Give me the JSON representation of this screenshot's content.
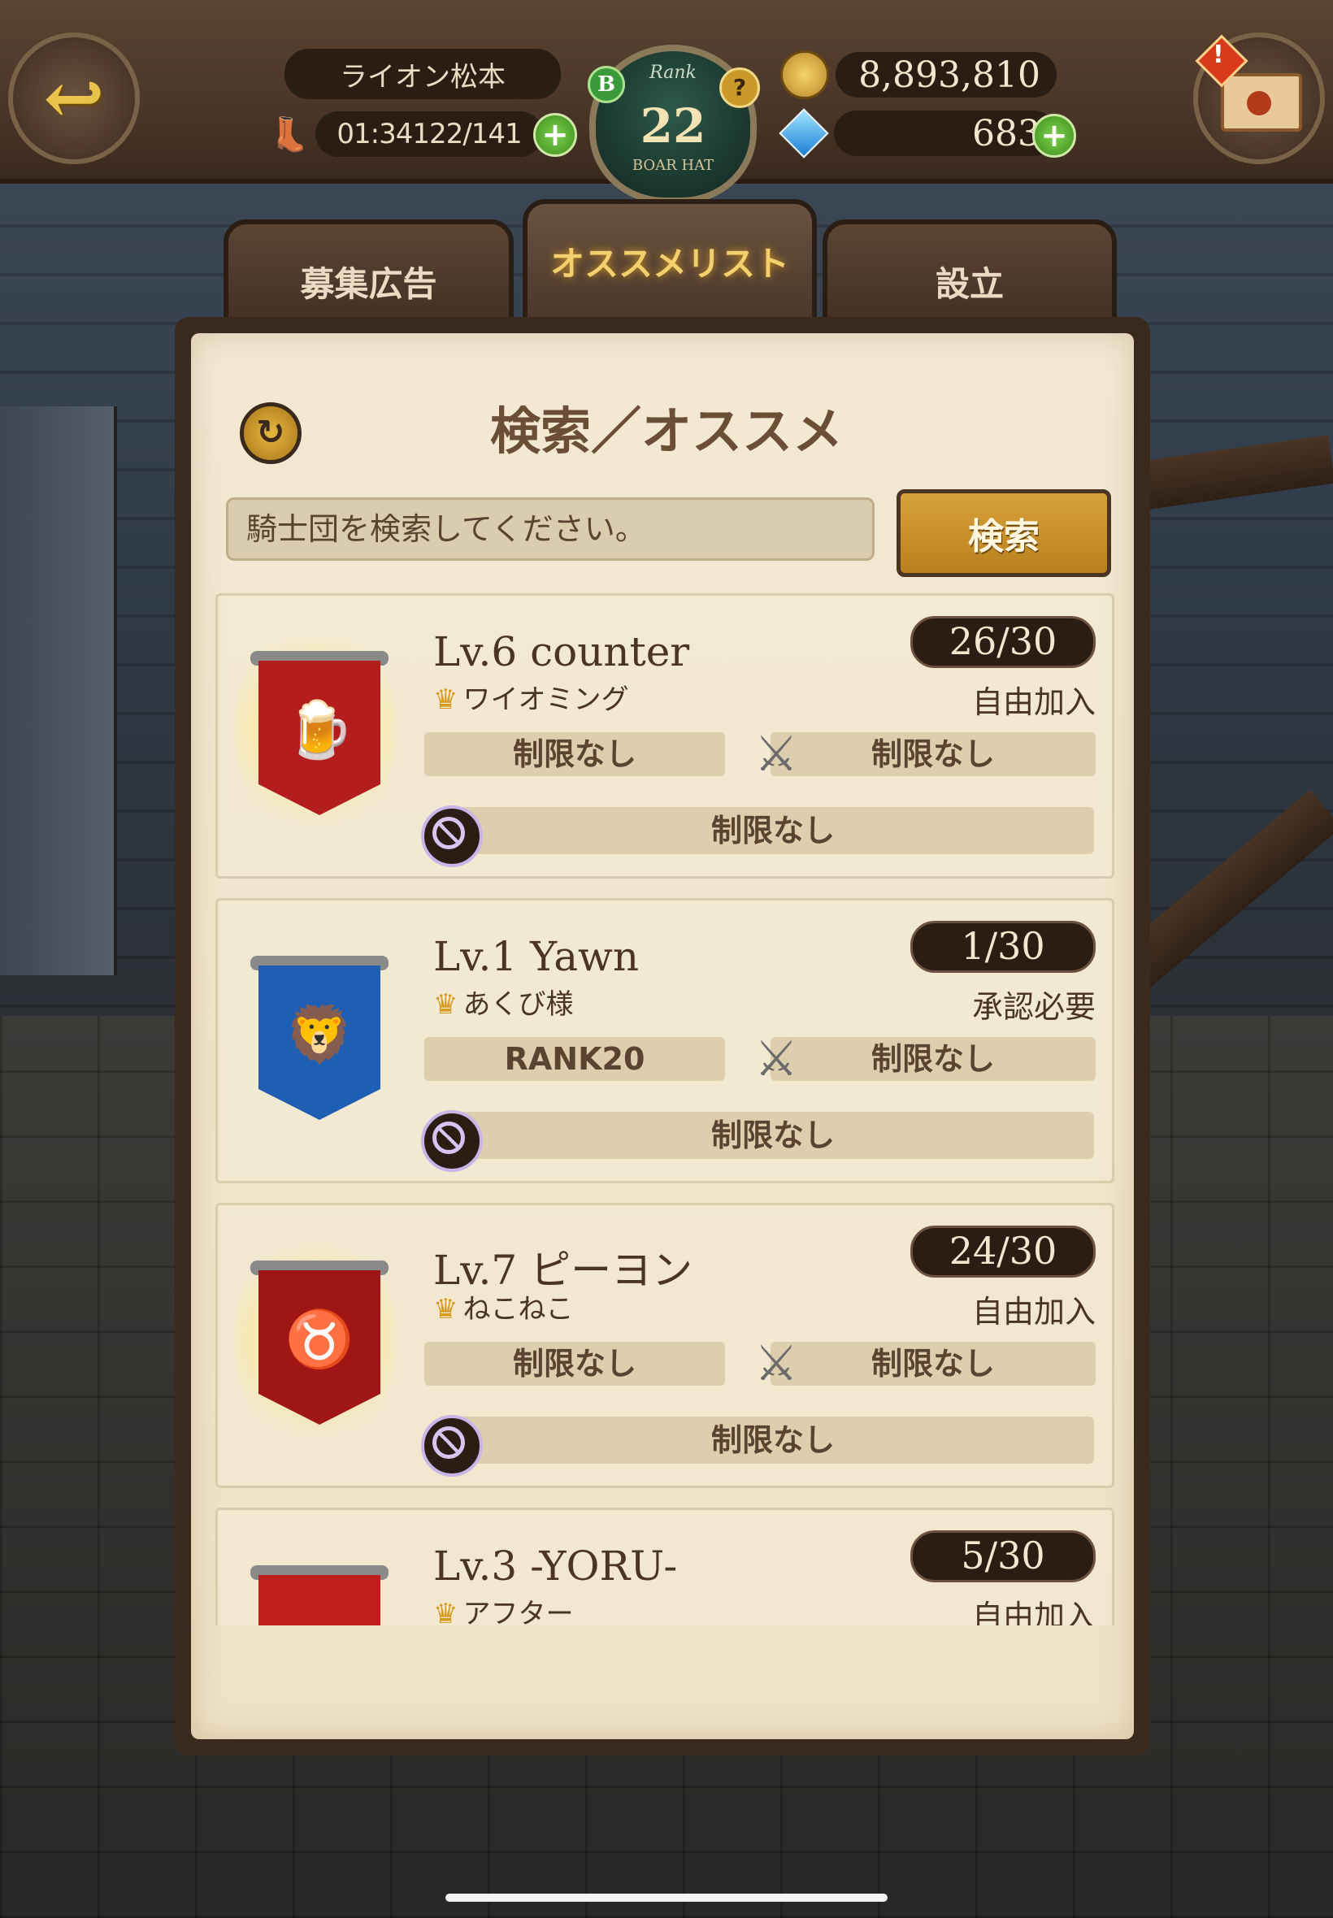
{
  "header": {
    "player_name": "ライオン松本",
    "stamina_time": "01:34",
    "stamina": "122/141",
    "rank_label": "Rank",
    "rank_value": "22",
    "rank_sub": "BOAR HAT",
    "rank_badge_letter": "B",
    "help_mark": "?",
    "gold": "8,893,810",
    "gems": "683",
    "plus": "+",
    "alert_mark": "!"
  },
  "tabs": [
    {
      "label": "募集広告",
      "active": false
    },
    {
      "label": "オススメリスト",
      "active": true
    },
    {
      "label": "設立",
      "active": false
    }
  ],
  "panel": {
    "title": "検索／オススメ",
    "search_placeholder": "騎士団を検索してください。",
    "search_button": "検索"
  },
  "knights": [
    {
      "level": "Lv.6  counter",
      "count": "26/30",
      "leader": "ワイオミング",
      "join": "自由加入",
      "req_rank": "制限なし",
      "req_power": "制限なし",
      "req_ban": "制限なし",
      "banner_color": "#b31d1d",
      "emblem": "🍺"
    },
    {
      "level": "Lv.1  Yawn",
      "count": "1/30",
      "leader": "あくび様",
      "join": "承認必要",
      "req_rank": "RANK20",
      "req_power": "制限なし",
      "req_ban": "制限なし",
      "banner_color": "#1f5fb3",
      "emblem": "🦁"
    },
    {
      "level": "Lv.7  ピーヨン",
      "count": "24/30",
      "leader": "ねこねこ",
      "join": "自由加入",
      "req_rank": "制限なし",
      "req_power": "制限なし",
      "req_ban": "制限なし",
      "banner_color": "#a01515",
      "emblem": "♉"
    },
    {
      "level": "Lv.3  -YORU-",
      "count": "5/30",
      "leader": "アフター",
      "join": "自由加入",
      "req_rank": "",
      "req_power": "",
      "req_ban": "",
      "banner_color": "#c01d1d",
      "emblem": ""
    }
  ],
  "icons": {
    "back": "back-arrow-icon",
    "boot": "boot-icon",
    "coin": "coin-icon",
    "gem": "gem-icon",
    "mail": "mail-icon",
    "refresh": "refresh-icon",
    "crown": "crown-icon",
    "swords": "crossed-swords-icon",
    "ban": "ban-icon"
  }
}
